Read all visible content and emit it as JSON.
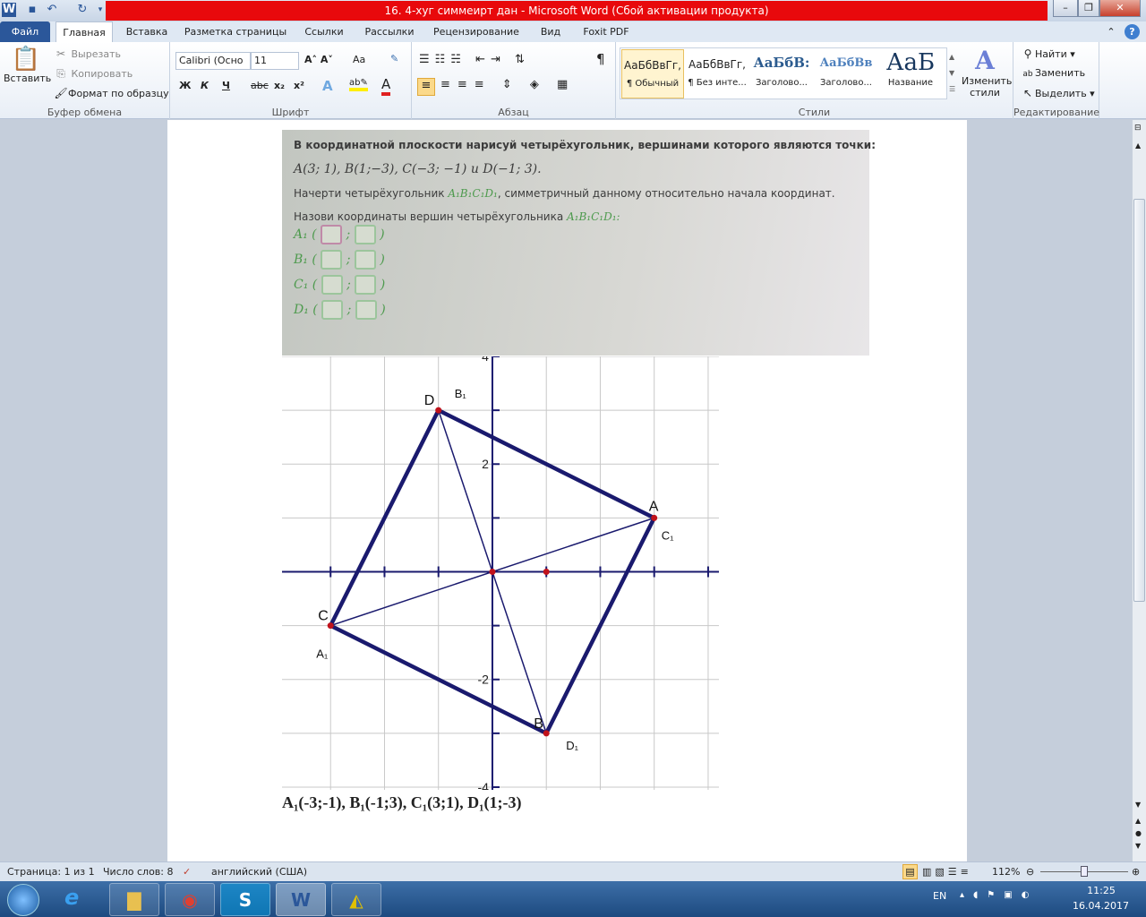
{
  "window": {
    "title": "16. 4-хуг симмеирт дан  -  Microsoft Word (Сбой активации продукта)"
  },
  "tabs": [
    "Файл",
    "Главная",
    "Вставка",
    "Разметка страницы",
    "Ссылки",
    "Рассылки",
    "Рецензирование",
    "Вид",
    "Foxit PDF"
  ],
  "ribbon": {
    "clipboard": {
      "paste": "Вставить",
      "cut": "Вырезать",
      "copy": "Копировать",
      "format_painter": "Формат по образцу",
      "label": "Буфер обмена"
    },
    "font": {
      "name": "Calibri (Осно",
      "size": "11",
      "bold": "Ж",
      "italic": "К",
      "underline": "Ч",
      "strike": "abc",
      "sub": "x₂",
      "sup": "x²",
      "case": "Aa",
      "label": "Шрифт"
    },
    "paragraph": {
      "label": "Абзац",
      "pilcrow": "¶"
    },
    "styles": {
      "items": [
        {
          "preview": "АаБбВвГг,",
          "name": "¶ Обычный"
        },
        {
          "preview": "АаБбВвГг,",
          "name": "¶ Без инте..."
        },
        {
          "preview": "АаБбВ:",
          "name": "Заголово..."
        },
        {
          "preview": "АаБбВв",
          "name": "Заголово..."
        },
        {
          "preview": "АаБ",
          "name": "Название"
        }
      ],
      "change": "Изменить стили",
      "label": "Стили"
    },
    "editing": {
      "find": "Найти",
      "replace": "Заменить",
      "select": "Выделить",
      "label": "Редактирование"
    }
  },
  "photo": {
    "line1": "В координатной плоскости нарисуй четырёхугольник, вершинами которого являются точки:",
    "line2": "A(3; 1), B(1;−3),  C(−3; −1) и D(−1; 3).",
    "line3a": "Начерти четырёхугольник ",
    "line3m": "A₁B₁C₁D₁",
    "line3b": ", симметричный данному относительно начала координат.",
    "line4a": "Назови координаты вершин четырёхугольника ",
    "line4m": "A₁B₁C₁D₁:",
    "rows": [
      "A₁",
      "B₁",
      "C₁",
      "D₁"
    ]
  },
  "chart_data": {
    "type": "scatter",
    "xlim": [
      -3.9,
      4.2
    ],
    "ylim": [
      -4.05,
      4
    ],
    "ytick_labels": [
      {
        "v": 4,
        "t": "4"
      },
      {
        "v": 2,
        "t": "2"
      },
      {
        "v": -2,
        "t": "-2"
      },
      {
        "v": -4,
        "t": "-4"
      }
    ],
    "grid": true,
    "points": [
      {
        "name": "A",
        "x": 3,
        "y": 1,
        "image": "C₁"
      },
      {
        "name": "B",
        "x": 1,
        "y": -3,
        "image": "D₁"
      },
      {
        "name": "C",
        "x": -3,
        "y": -1,
        "image": "A₁"
      },
      {
        "name": "D",
        "x": -1,
        "y": 3,
        "image": "B₁"
      }
    ],
    "extra_points": [
      {
        "x": 0,
        "y": 0
      },
      {
        "x": 1,
        "y": 0
      }
    ],
    "polygon": [
      "A",
      "B",
      "C",
      "D"
    ],
    "diagonals": [
      [
        "D",
        "B"
      ],
      [
        "C",
        "A"
      ]
    ],
    "colors": {
      "line": "#1a1a6e",
      "point": "#c0121b",
      "grid": "#c8c8c8"
    }
  },
  "answer": "A₁(-3;-1),  B₁(-1;3),  C₁(3;1),  D₁(1;-3)",
  "status": {
    "page": "Страница: 1 из 1",
    "words": "Число слов: 8",
    "lang": "английский (США)",
    "zoom": "112%",
    "zoom_value": 112
  },
  "tray": {
    "lang": "EN",
    "time": "11:25",
    "date": "16.04.2017"
  }
}
